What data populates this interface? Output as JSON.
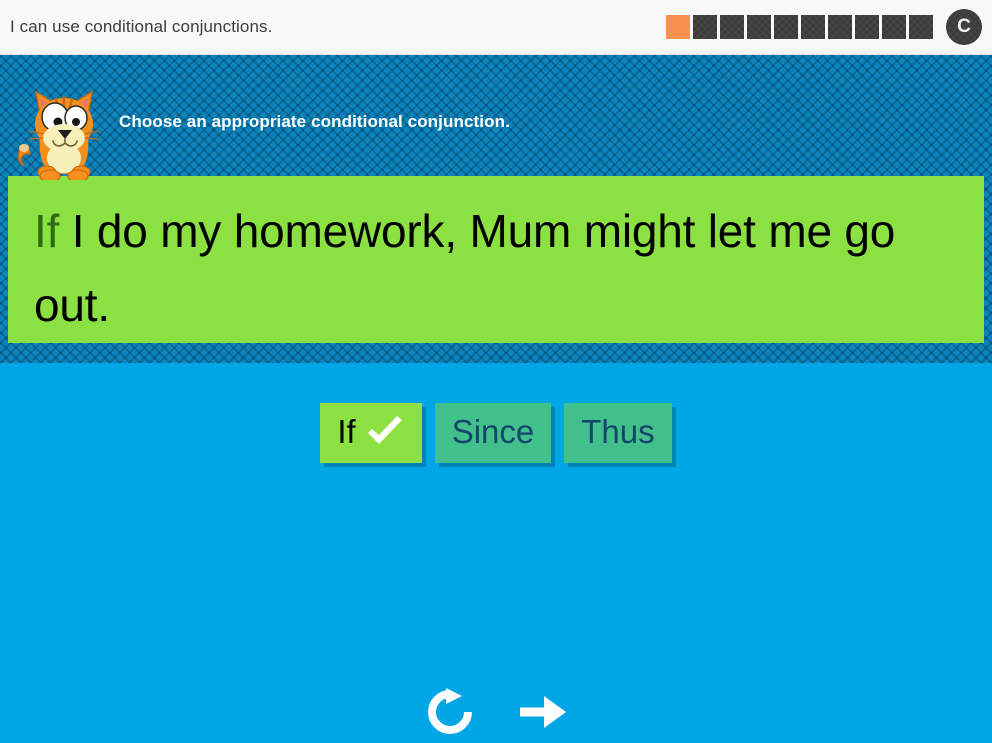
{
  "header": {
    "title": "I can use conditional conjunctions.",
    "progress": {
      "total": 10,
      "completed": 1,
      "completed_color": "#F9904F",
      "pending_color": "#3B3B3B"
    },
    "reset_button": {
      "label": "C",
      "icon": "restart-c-icon"
    }
  },
  "activity": {
    "prompt": "Choose an appropriate conditional conjunction.",
    "mascot": "orange-cat-mascot",
    "sentence": {
      "blank_filled": "If",
      "rest": " I do my homework, Mum might let me go out.",
      "full_text": "If I do my homework, Mum might let me go out.",
      "panel_color": "#8CE142",
      "blank_color": "#2E6B13"
    },
    "choices": [
      {
        "label": "If",
        "selected": true,
        "correct": true,
        "icon": "check-icon"
      },
      {
        "label": "Since",
        "selected": false,
        "correct": false,
        "icon": ""
      },
      {
        "label": "Thus",
        "selected": false,
        "correct": false,
        "icon": ""
      }
    ]
  },
  "footer": {
    "replay_button": {
      "icon": "refresh-icon",
      "label": "Replay"
    },
    "next_button": {
      "icon": "arrow-right-icon",
      "label": "Next"
    }
  },
  "theme": {
    "header_bg": "#F8F8F8",
    "stage_textured_bg": "#0D84BE",
    "stage_flat_bg": "#00A6E6",
    "choice_bg": "#42C08C",
    "choice_text": "#14456B",
    "selected_bg": "#8CE142"
  }
}
